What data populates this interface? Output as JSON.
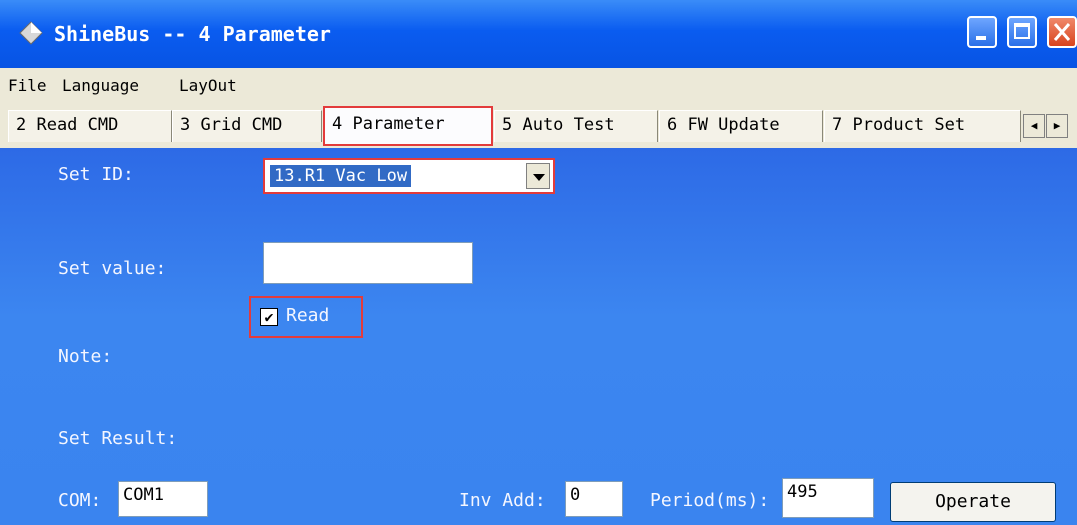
{
  "window": {
    "title": "ShineBus -- 4 Parameter"
  },
  "menu": {
    "items": [
      "File",
      "Language",
      "LayOut"
    ]
  },
  "tabs": [
    "2 Read CMD",
    "3 Grid CMD",
    "4 Parameter",
    "5 Auto Test",
    "6 FW Update",
    "7 Product Set"
  ],
  "active_tab": "4 Parameter",
  "form": {
    "set_id_label": "Set ID:",
    "set_id_value": "13.R1 Vac Low",
    "set_value_label": "Set value:",
    "set_value": "",
    "read_label": "Read",
    "read_checked": true,
    "note_label": "Note:",
    "set_result_label": "Set Result:",
    "com_label": "COM:",
    "com_value": "COM1",
    "inv_add_label": "Inv Add:",
    "inv_add_value": "0",
    "period_label": "Period(ms):",
    "period_value": "495",
    "operate_label": "Operate"
  },
  "icons": {
    "app": "diamond-app-icon",
    "scroll_left": "arrow-left-icon",
    "scroll_right": "arrow-right-icon"
  }
}
